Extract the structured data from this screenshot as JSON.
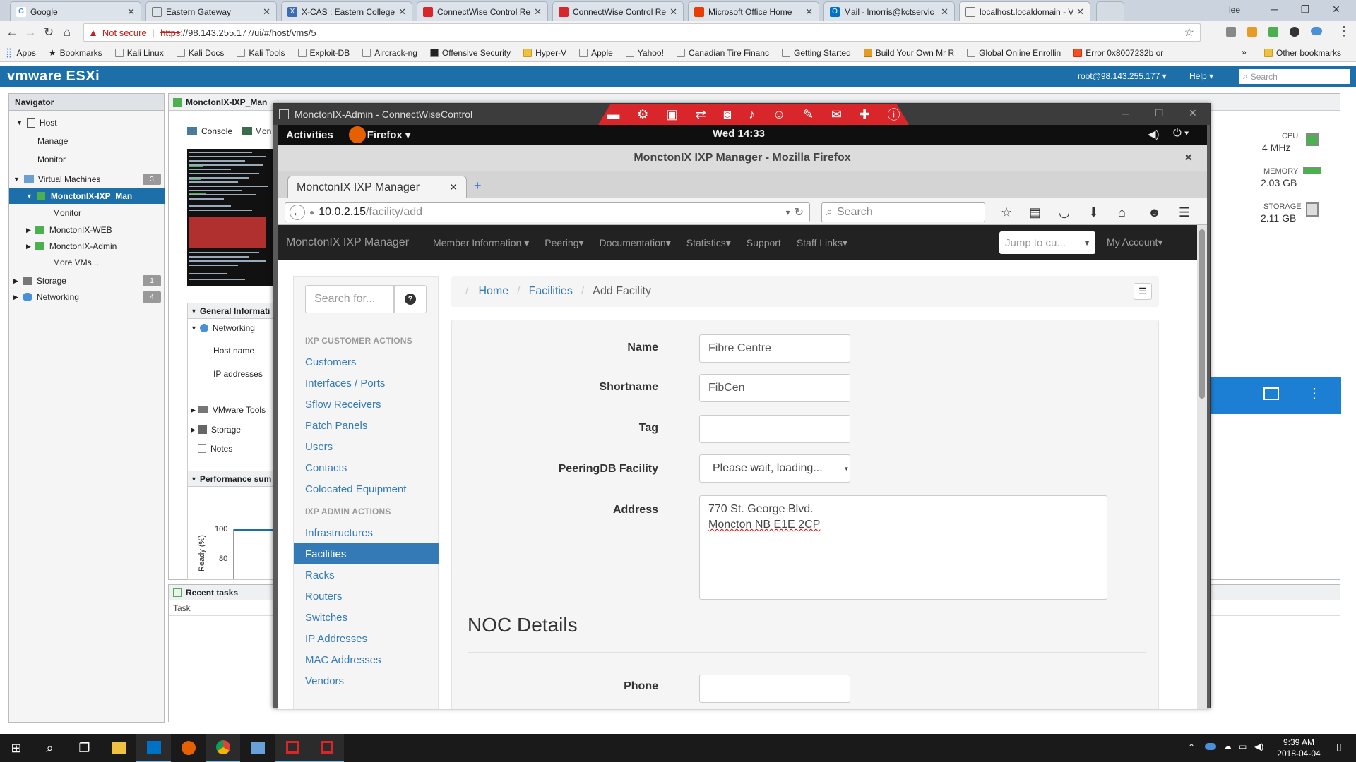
{
  "chrome": {
    "tabs": [
      {
        "title": "Google",
        "icon": "google-icon",
        "color": "#4285f4"
      },
      {
        "title": "Eastern Gateway",
        "icon": "page-icon",
        "color": "#888888"
      },
      {
        "title": "X-CAS : Eastern College",
        "icon": "xcas-icon",
        "color": "#3a6db5"
      },
      {
        "title": "ConnectWise Control Re",
        "icon": "connectwise-icon",
        "color": "#d8262a"
      },
      {
        "title": "ConnectWise Control Re",
        "icon": "connectwise-icon",
        "color": "#d8262a"
      },
      {
        "title": "Microsoft Office Home",
        "icon": "office-icon",
        "color": "#eb3c00"
      },
      {
        "title": "Mail - lmorris@kctservic",
        "icon": "outlook-icon",
        "color": "#0072c6"
      },
      {
        "title": "localhost.localdomain - V",
        "icon": "page-icon",
        "color": "#888888"
      }
    ],
    "user_label": "lee",
    "not_secure": "Not secure",
    "url_scheme": "https",
    "url_rest": "://98.143.255.177/ui/#/host/vms/5",
    "bookmarks": [
      "Apps",
      "Bookmarks",
      "Kali Linux",
      "Kali Docs",
      "Kali Tools",
      "Exploit-DB",
      "Aircrack-ng",
      "Offensive Security",
      "Hyper-V",
      "Apple",
      "Yahoo!",
      "Canadian Tire Financ",
      "Getting Started",
      "Build Your Own Mr R",
      "Global Online Enrollin",
      "Error 0x8007232b or"
    ],
    "other_bookmarks": "Other bookmarks"
  },
  "esxi": {
    "logo": "vmware ESXi",
    "user": "root@98.143.255.177",
    "help": "Help",
    "search_placeholder": "Search",
    "navigator_title": "Navigator",
    "nav": {
      "host": "Host",
      "manage": "Manage",
      "monitor": "Monitor",
      "vms": "Virtual Machines",
      "vms_count": "3",
      "vm_selected": "MonctonIX-IXP_Man",
      "vm_monitor": "Monitor",
      "vm_web": "MonctonIX-WEB",
      "vm_admin": "MonctonIX-Admin",
      "more_vms": "More VMs...",
      "storage": "Storage",
      "storage_count": "1",
      "networking": "Networking",
      "networking_count": "4"
    },
    "vm_tab": "MonctonIX-IXP_Man",
    "console": "Console",
    "monitor_short": "Mon",
    "general_info": "General Informati",
    "gi_networking": "Networking",
    "gi_hostname": "Host name",
    "gi_ip": "IP addresses",
    "gi_vmtools": "VMware Tools",
    "gi_storage": "Storage",
    "gi_notes": "Notes",
    "perf_summary": "Performance sum",
    "perf_ylabel": "Ready (%)",
    "perf_y100": "100",
    "perf_y80": "80",
    "recent_tasks": "Recent tasks",
    "task_col": "Task",
    "stats": {
      "cpu_label": "CPU",
      "cpu_value": "4 MHz",
      "memory_label": "MEMORY",
      "memory_value": "2.03 GB",
      "storage_label": "STORAGE",
      "storage_value": "2.11 GB"
    }
  },
  "connectwise": {
    "title": "MonctonIX-Admin - ConnectWiseControl",
    "gnome": {
      "activities": "Activities",
      "app": "Firefox",
      "clock": "Wed 14:33"
    },
    "firefox": {
      "window_title": "MonctonIX IXP Manager - Mozilla Firefox",
      "tab_title": "MonctonIX IXP Manager",
      "url_host": "10.0.2.15",
      "url_path": "/facility/add",
      "search_placeholder": "Search"
    },
    "ixp": {
      "brand": "MonctonIX IXP Manager",
      "menu": [
        "Member Information",
        "Peering",
        "Documentation",
        "Statistics",
        "Support",
        "Staff Links"
      ],
      "jump_placeholder": "Jump to cu...",
      "account": "My Account",
      "search_placeholder": "Search for...",
      "customer_actions_head": "IXP CUSTOMER ACTIONS",
      "customer_actions": [
        "Customers",
        "Interfaces / Ports",
        "Sflow Receivers",
        "Patch Panels",
        "Users",
        "Contacts",
        "Colocated Equipment"
      ],
      "admin_actions_head": "IXP ADMIN ACTIONS",
      "admin_actions": [
        "Infrastructures",
        "Facilities",
        "Racks",
        "Routers",
        "Switches",
        "IP Addresses",
        "MAC Addresses",
        "Vendors"
      ],
      "breadcrumb": [
        "Home",
        "Facilities",
        "Add Facility"
      ],
      "form": {
        "name_label": "Name",
        "name_value": "Fibre Centre",
        "shortname_label": "Shortname",
        "shortname_value": "FibCen",
        "tag_label": "Tag",
        "tag_value": "",
        "peeringdb_label": "PeeringDB Facility",
        "peeringdb_value": "Please wait, loading...",
        "address_label": "Address",
        "address_line1": "770 St. George Blvd.",
        "address_line2": "Moncton NB E1E 2CP",
        "noc_heading": "NOC Details",
        "phone_label": "Phone"
      }
    }
  },
  "taskbar": {
    "time": "9:39 AM",
    "date": "2018-04-04"
  }
}
